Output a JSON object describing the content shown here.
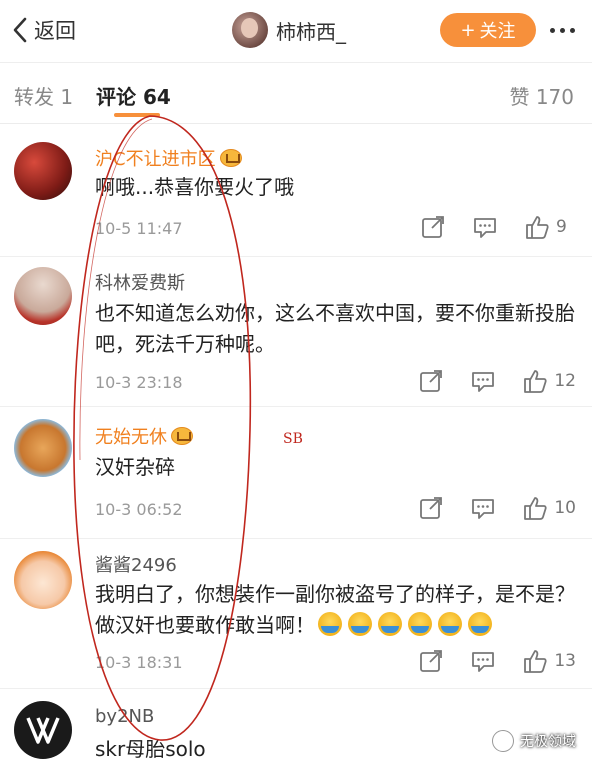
{
  "header": {
    "back_label": "返回",
    "user_name": "柿柿西_",
    "follow_label": "关注",
    "follow_plus": "+"
  },
  "tabs": {
    "repost": "转发 1",
    "comments": "评论 64",
    "likes": "赞 170"
  },
  "comments": [
    {
      "name": "沪C不让进市区",
      "vip": true,
      "text": "啊哦...恭喜你要火了哦",
      "time": "10-5 11:47",
      "likes": "9"
    },
    {
      "name": "科林爱费斯",
      "vip": false,
      "text": "也不知道怎么劝你，这么不喜欢中国，要不你重新投胎吧，死法千万种呢。",
      "time": "10-3 23:18",
      "likes": "12"
    },
    {
      "name": "无始无休",
      "vip": true,
      "text": "汉奸杂碎",
      "time": "10-3 06:52",
      "likes": "10"
    },
    {
      "name": "酱酱2496",
      "vip": false,
      "text": "我明白了，你想装作一副你被盗号了的样子，是不是？做汉奸也要敢作敢当啊！",
      "time": "10-3 18:31",
      "likes": "13",
      "emoji_count": 6
    },
    {
      "name": "by2NB",
      "vip": false,
      "text": "skr母胎solo"
    }
  ],
  "annotation_text": "SB",
  "watermark": "无极领域",
  "colors": {
    "accent": "#f7903b",
    "vip_name": "#f0801f",
    "annotation": "#c0271e"
  },
  "icons": [
    "back-chevron-icon",
    "more-dots-icon",
    "share-icon",
    "comment-icon",
    "like-icon",
    "vip-crown-icon",
    "cry-emoji-icon",
    "watermark-logo-icon"
  ]
}
